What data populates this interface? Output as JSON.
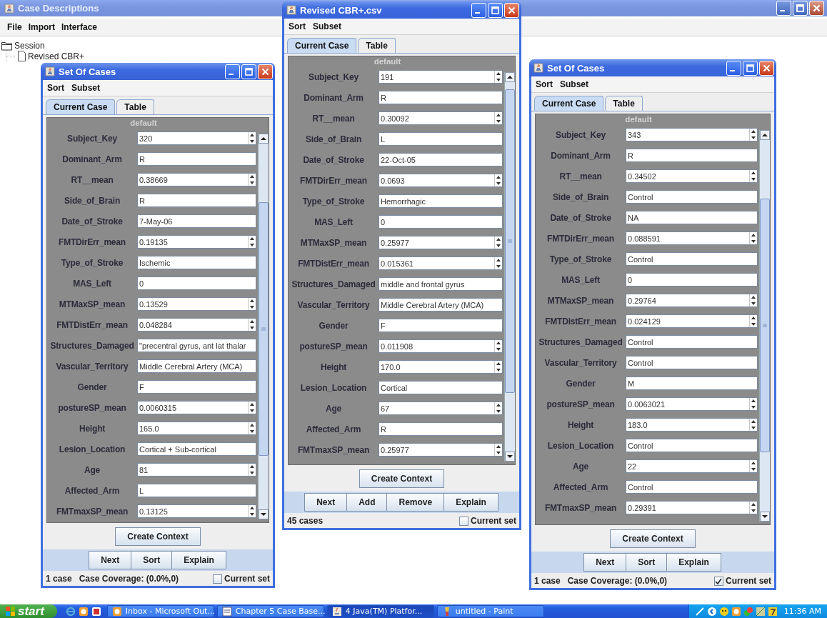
{
  "main_window": {
    "title": "Case Descriptions",
    "menu": [
      "File",
      "Import",
      "Interface"
    ],
    "tree": [
      {
        "label": "Session",
        "children": [
          {
            "label": "Revised CBR+"
          }
        ]
      }
    ]
  },
  "case_windows": [
    {
      "title": "Set Of Cases",
      "menu": [
        "Sort",
        "Subset"
      ],
      "tabs": [
        {
          "label": "Current Case",
          "selected": true
        },
        {
          "label": "Table",
          "selected": false
        }
      ],
      "group_label": "default",
      "fields": [
        {
          "label": "Subject_Key",
          "value": "320",
          "kind": "spinner"
        },
        {
          "label": "Dominant_Arm",
          "value": "R",
          "kind": "text"
        },
        {
          "label": "RT__mean",
          "value": "0.38669",
          "kind": "spinner"
        },
        {
          "label": "Side_of_Brain",
          "value": "R",
          "kind": "text"
        },
        {
          "label": "Date_of_Stroke",
          "value": "7-May-06",
          "kind": "text"
        },
        {
          "label": "FMTDirErr_mean",
          "value": "0.19135",
          "kind": "spinner"
        },
        {
          "label": "Type_of_Stroke",
          "value": "Ischemic",
          "kind": "text"
        },
        {
          "label": "MAS_Left",
          "value": "0",
          "kind": "text"
        },
        {
          "label": "MTMaxSP_mean",
          "value": "0.13529",
          "kind": "spinner"
        },
        {
          "label": "FMTDistErr_mean",
          "value": "0.048284",
          "kind": "spinner"
        },
        {
          "label": "Structures_Damaged",
          "value": "\"precentral gyrus, ant lat thalar",
          "kind": "text"
        },
        {
          "label": "Vascular_Territory",
          "value": "Middle Cerebral Artery (MCA)",
          "kind": "text"
        },
        {
          "label": "Gender",
          "value": "F",
          "kind": "text"
        },
        {
          "label": "postureSP_mean",
          "value": "0.0060315",
          "kind": "spinner"
        },
        {
          "label": "Height",
          "value": "165.0",
          "kind": "spinner"
        },
        {
          "label": "Lesion_Location",
          "value": "Cortical + Sub-cortical",
          "kind": "text"
        },
        {
          "label": "Age",
          "value": "81",
          "kind": "spinner"
        },
        {
          "label": "Affected_Arm",
          "value": "L",
          "kind": "text"
        },
        {
          "label": "FMTmaxSP_mean",
          "value": "0.13125",
          "kind": "spinner"
        }
      ],
      "create_button": "Create Context",
      "buttons": [
        "Next",
        "Sort",
        "Explain"
      ],
      "count": "1 case",
      "coverage": "Case Coverage: (0.0%,0)",
      "current_set": {
        "label": "Current set",
        "checked": false
      }
    },
    {
      "title": "Revised CBR+.csv",
      "menu": [
        "Sort",
        "Subset"
      ],
      "tabs": [
        {
          "label": "Current Case",
          "selected": true
        },
        {
          "label": "Table",
          "selected": false
        }
      ],
      "group_label": "default",
      "fields": [
        {
          "label": "Subject_Key",
          "value": "191",
          "kind": "spinner"
        },
        {
          "label": "Dominant_Arm",
          "value": "R",
          "kind": "text"
        },
        {
          "label": "RT__mean",
          "value": "0.30092",
          "kind": "spinner"
        },
        {
          "label": "Side_of_Brain",
          "value": "L",
          "kind": "text"
        },
        {
          "label": "Date_of_Stroke",
          "value": "22-Oct-05",
          "kind": "text"
        },
        {
          "label": "FMTDirErr_mean",
          "value": "0.0693",
          "kind": "spinner"
        },
        {
          "label": "Type_of_Stroke",
          "value": "Hemorrhagic",
          "kind": "text"
        },
        {
          "label": "MAS_Left",
          "value": "0",
          "kind": "text"
        },
        {
          "label": "MTMaxSP_mean",
          "value": "0.25977",
          "kind": "spinner"
        },
        {
          "label": "FMTDistErr_mean",
          "value": "0.015361",
          "kind": "spinner"
        },
        {
          "label": "Structures_Damaged",
          "value": "middle and frontal gyrus",
          "kind": "text"
        },
        {
          "label": "Vascular_Territory",
          "value": "Middle Cerebral Artery (MCA)",
          "kind": "text"
        },
        {
          "label": "Gender",
          "value": "F",
          "kind": "text"
        },
        {
          "label": "postureSP_mean",
          "value": "0.011908",
          "kind": "spinner"
        },
        {
          "label": "Height",
          "value": "170.0",
          "kind": "spinner"
        },
        {
          "label": "Lesion_Location",
          "value": "Cortical",
          "kind": "text"
        },
        {
          "label": "Age",
          "value": "67",
          "kind": "spinner"
        },
        {
          "label": "Affected_Arm",
          "value": "R",
          "kind": "text"
        },
        {
          "label": "FMTmaxSP_mean",
          "value": "0.25977",
          "kind": "spinner"
        }
      ],
      "create_button": "Create Context",
      "buttons": [
        "Next",
        "Add",
        "Remove",
        "Explain"
      ],
      "count": "45 cases",
      "current_set": {
        "label": "Current set",
        "checked": false
      }
    },
    {
      "title": "Set Of Cases",
      "menu": [
        "Sort",
        "Subset"
      ],
      "tabs": [
        {
          "label": "Current Case",
          "selected": true
        },
        {
          "label": "Table",
          "selected": false
        }
      ],
      "group_label": "default",
      "fields": [
        {
          "label": "Subject_Key",
          "value": "343",
          "kind": "spinner"
        },
        {
          "label": "Dominant_Arm",
          "value": "R",
          "kind": "text"
        },
        {
          "label": "RT__mean",
          "value": "0.34502",
          "kind": "spinner"
        },
        {
          "label": "Side_of_Brain",
          "value": "Control",
          "kind": "text"
        },
        {
          "label": "Date_of_Stroke",
          "value": "NA",
          "kind": "text"
        },
        {
          "label": "FMTDirErr_mean",
          "value": "0.088591",
          "kind": "spinner"
        },
        {
          "label": "Type_of_Stroke",
          "value": "Control",
          "kind": "text"
        },
        {
          "label": "MAS_Left",
          "value": "0",
          "kind": "text"
        },
        {
          "label": "MTMaxSP_mean",
          "value": "0.29764",
          "kind": "spinner"
        },
        {
          "label": "FMTDistErr_mean",
          "value": "0.024129",
          "kind": "spinner"
        },
        {
          "label": "Structures_Damaged",
          "value": "Control",
          "kind": "text"
        },
        {
          "label": "Vascular_Territory",
          "value": "Control",
          "kind": "text"
        },
        {
          "label": "Gender",
          "value": "M",
          "kind": "text"
        },
        {
          "label": "postureSP_mean",
          "value": "0.0063021",
          "kind": "spinner"
        },
        {
          "label": "Height",
          "value": "183.0",
          "kind": "spinner"
        },
        {
          "label": "Lesion_Location",
          "value": "Control",
          "kind": "text"
        },
        {
          "label": "Age",
          "value": "22",
          "kind": "spinner"
        },
        {
          "label": "Affected_Arm",
          "value": "Control",
          "kind": "text"
        },
        {
          "label": "FMTmaxSP_mean",
          "value": "0.29391",
          "kind": "spinner"
        }
      ],
      "create_button": "Create Context",
      "buttons": [
        "Next",
        "Sort",
        "Explain"
      ],
      "count": "1 case",
      "coverage": "Case Coverage: (0.0%,0)",
      "current_set": {
        "label": "Current set",
        "checked": true
      }
    }
  ],
  "taskbar": {
    "start": "start",
    "tasks": [
      {
        "label": "Inbox - Microsoft Out...",
        "selected": false
      },
      {
        "label": "Chapter 5 Case Base...",
        "selected": false
      },
      {
        "label": "4 Java(TM) Platfor...",
        "selected": true
      },
      {
        "label": "untitled - Paint",
        "selected": false
      }
    ],
    "clock": "11:36 AM"
  }
}
